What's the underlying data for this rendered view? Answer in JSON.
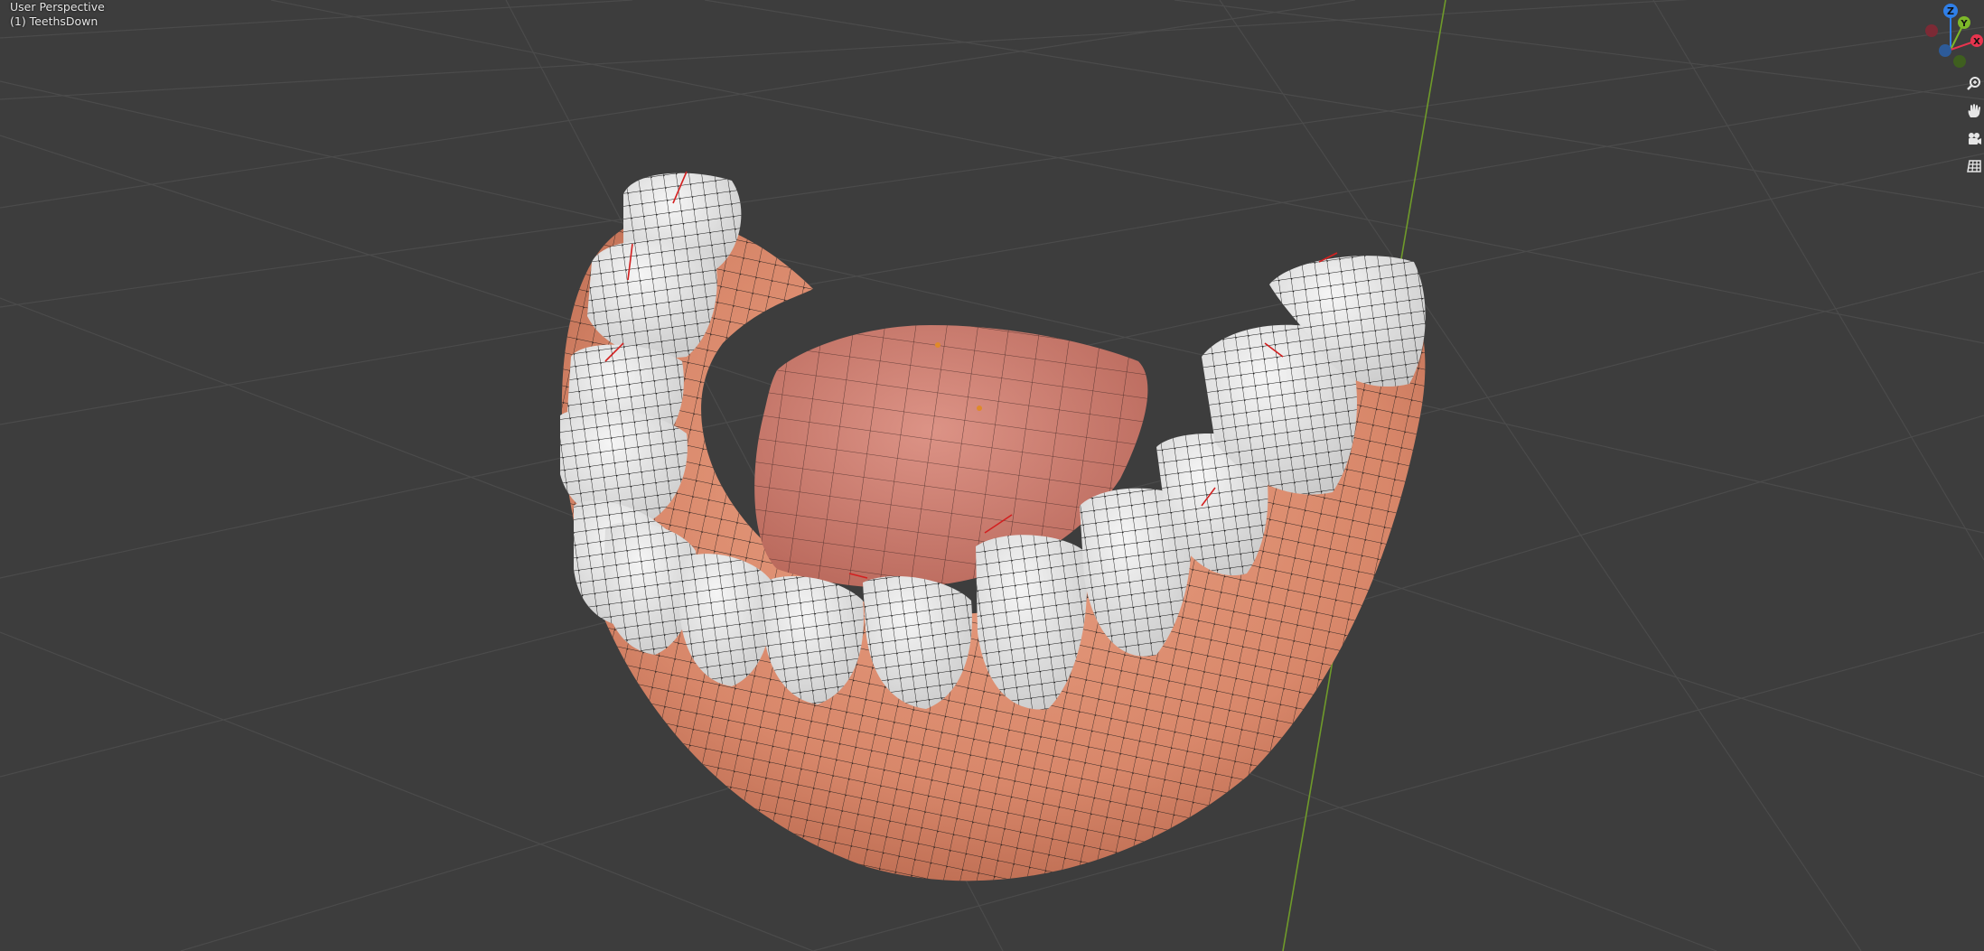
{
  "viewport": {
    "view_name": "User Perspective",
    "object_name": "(1) TeethsDown"
  },
  "gizmo": {
    "axes": [
      {
        "label": "Z",
        "color": "#2f7fe8"
      },
      {
        "label": "Y",
        "color": "#7db829"
      },
      {
        "label": "X",
        "color": "#e8344e"
      }
    ]
  },
  "navigation": [
    {
      "name": "zoom",
      "icon": "zoom-icon"
    },
    {
      "name": "pan",
      "icon": "hand-icon"
    },
    {
      "name": "camera",
      "icon": "camera-icon"
    },
    {
      "name": "ortho",
      "icon": "grid-icon"
    }
  ],
  "colors": {
    "background": "#3d3d3d",
    "grid": "#4b4b4b",
    "y_axis_line": "#6f9a2a",
    "gum": "#d8876a",
    "tooth": "#e4e4e4",
    "tongue": "#c87668"
  }
}
